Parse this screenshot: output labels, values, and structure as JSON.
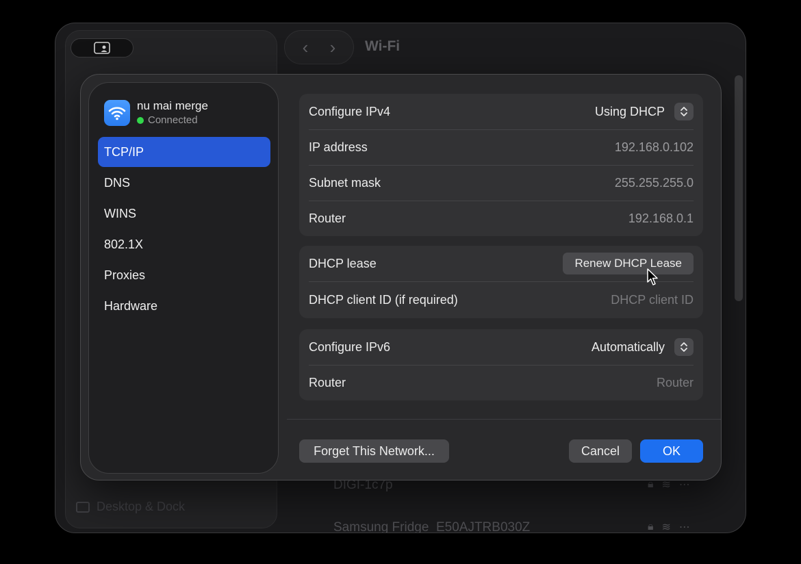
{
  "window": {
    "title": "Wi-Fi",
    "nav": {
      "back": "‹",
      "forward": "›"
    }
  },
  "background": {
    "sidebar_item": "Desktop & Dock",
    "networks": [
      {
        "name": "DIGI-1c7p"
      },
      {
        "name": "Samsung Fridge_E50AJTRB030Z"
      }
    ]
  },
  "sheet": {
    "network": {
      "name": "nu mai merge",
      "status": "Connected",
      "status_color": "#32d74b"
    },
    "sidebar": [
      {
        "label": "TCP/IP",
        "active": true
      },
      {
        "label": "DNS"
      },
      {
        "label": "WINS"
      },
      {
        "label": "802.1X"
      },
      {
        "label": "Proxies"
      },
      {
        "label": "Hardware"
      }
    ],
    "ipv4": {
      "configure_label": "Configure IPv4",
      "configure_value": "Using DHCP",
      "ip_label": "IP address",
      "ip_value": "192.168.0.102",
      "subnet_label": "Subnet mask",
      "subnet_value": "255.255.255.0",
      "router_label": "Router",
      "router_value": "192.168.0.1"
    },
    "dhcp": {
      "lease_label": "DHCP lease",
      "renew_button": "Renew DHCP Lease",
      "client_id_label": "DHCP client ID (if required)",
      "client_id_placeholder": "DHCP client ID"
    },
    "ipv6": {
      "configure_label": "Configure IPv6",
      "configure_value": "Automatically",
      "router_label": "Router",
      "router_placeholder": "Router"
    },
    "buttons": {
      "forget": "Forget This Network...",
      "cancel": "Cancel",
      "ok": "OK"
    }
  },
  "colors": {
    "accent": "#2759d6",
    "primary_button": "#1d6ff0"
  }
}
